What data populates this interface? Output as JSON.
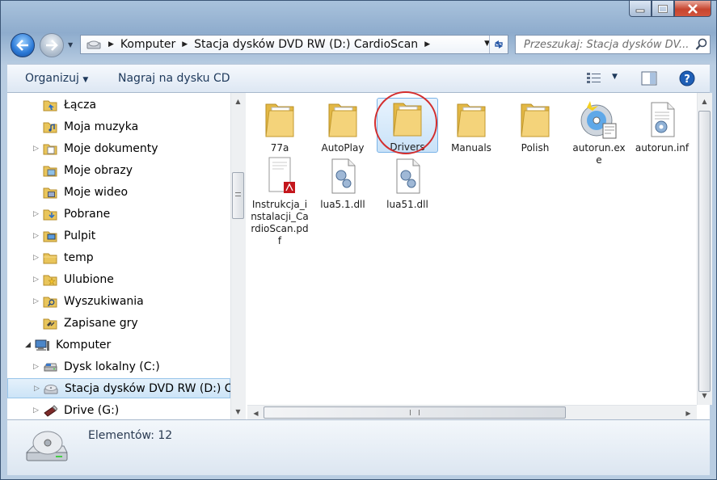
{
  "address": {
    "segments": [
      "Komputer",
      "Stacja dysków DVD RW (D:) CardioScan"
    ]
  },
  "search": {
    "placeholder": "Przeszukaj: Stacja dysków DV..."
  },
  "toolbar": {
    "organize_label": "Organizuj",
    "burn_label": "Nagraj na dysku CD"
  },
  "sidebar": {
    "items": [
      {
        "label": "Łącza",
        "icon": "links-folder-icon"
      },
      {
        "label": "Moja muzyka",
        "icon": "music-folder-icon"
      },
      {
        "label": "Moje dokumenty",
        "icon": "documents-folder-icon"
      },
      {
        "label": "Moje obrazy",
        "icon": "pictures-folder-icon"
      },
      {
        "label": "Moje wideo",
        "icon": "video-folder-icon"
      },
      {
        "label": "Pobrane",
        "icon": "downloads-folder-icon"
      },
      {
        "label": "Pulpit",
        "icon": "desktop-folder-icon"
      },
      {
        "label": "temp",
        "icon": "folder-icon"
      },
      {
        "label": "Ulubione",
        "icon": "favorites-folder-icon"
      },
      {
        "label": "Wyszukiwania",
        "icon": "searches-folder-icon"
      },
      {
        "label": "Zapisane gry",
        "icon": "saved-games-folder-icon"
      },
      {
        "label": "Komputer",
        "icon": "computer-icon"
      },
      {
        "label": "Dysk lokalny (C:)",
        "icon": "local-disk-icon"
      },
      {
        "label": "Stacja dysków DVD RW (D:) CardioScan",
        "icon": "dvd-drive-icon"
      },
      {
        "label": "Drive (G:)",
        "icon": "usb-drive-icon"
      }
    ]
  },
  "files": [
    {
      "name": "77a",
      "type": "folder"
    },
    {
      "name": "AutoPlay",
      "type": "folder"
    },
    {
      "name": "Drivers",
      "type": "folder"
    },
    {
      "name": "Manuals",
      "type": "folder"
    },
    {
      "name": "Polish",
      "type": "folder"
    },
    {
      "name": "autorun.exe",
      "type": "exe"
    },
    {
      "name": "autorun.inf",
      "type": "inf"
    },
    {
      "name": "Instrukcja_instalacji_CardioScan.pdf",
      "type": "pdf"
    },
    {
      "name": "lua5.1.dll",
      "type": "dll"
    },
    {
      "name": "lua51.dll",
      "type": "dll"
    }
  ],
  "status": {
    "text": "Elementów: 12"
  },
  "colors": {
    "highlight_circle": "#d32d2d",
    "selection": "#cce4f7",
    "toolbar_text": "#1e395b"
  }
}
